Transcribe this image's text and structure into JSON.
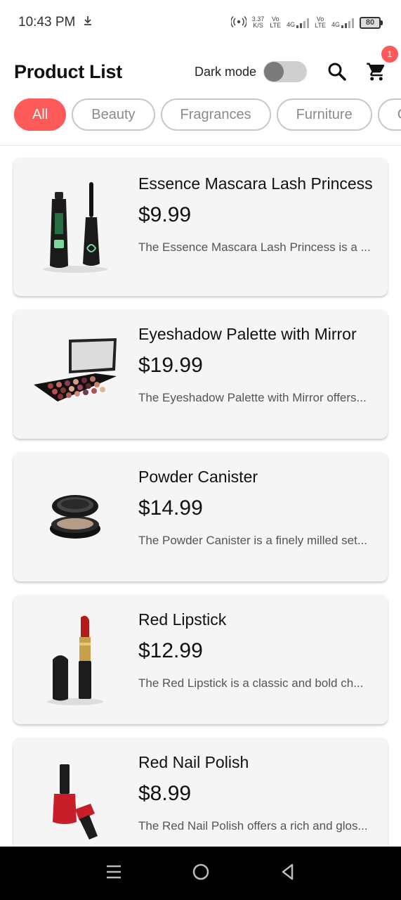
{
  "status": {
    "time": "10:43 PM",
    "speed": "3.37",
    "speed_unit": "K/S",
    "net1_top": "Vo",
    "net1_bottom": "LTE",
    "net1_gen": "4G",
    "net2_top": "Vo",
    "net2_bottom": "LTE",
    "net2_gen": "4G",
    "battery": "80"
  },
  "header": {
    "title": "Product List",
    "dark_mode_label": "Dark mode",
    "dark_mode_on": false,
    "cart_count": "1"
  },
  "categories": [
    "All",
    "Beauty",
    "Fragrances",
    "Furniture",
    "G"
  ],
  "active_category": "All",
  "products": [
    {
      "title": "Essence Mascara Lash Princess",
      "price": "$9.99",
      "description": "The Essence Mascara Lash Princess is a ..."
    },
    {
      "title": "Eyeshadow Palette with Mirror",
      "price": "$19.99",
      "description": "The Eyeshadow Palette with Mirror offers..."
    },
    {
      "title": "Powder Canister",
      "price": "$14.99",
      "description": "The Powder Canister is a finely milled set..."
    },
    {
      "title": "Red Lipstick",
      "price": "$12.99",
      "description": "The Red Lipstick is a classic and bold ch..."
    },
    {
      "title": "Red Nail Polish",
      "price": "$8.99",
      "description": "The Red Nail Polish offers a rich and glos..."
    }
  ],
  "colors": {
    "accent": "#ff5a5a",
    "card_bg": "#f5f5f5",
    "chip_border": "#c8c8c8",
    "nav_bg": "#000000"
  },
  "icons": {
    "status_download": "download-icon",
    "hotspot": "hotspot-icon",
    "search": "search-icon",
    "cart": "cart-icon",
    "nav_menu": "menu-icon",
    "nav_home": "home-circle-icon",
    "nav_back": "back-triangle-icon"
  }
}
